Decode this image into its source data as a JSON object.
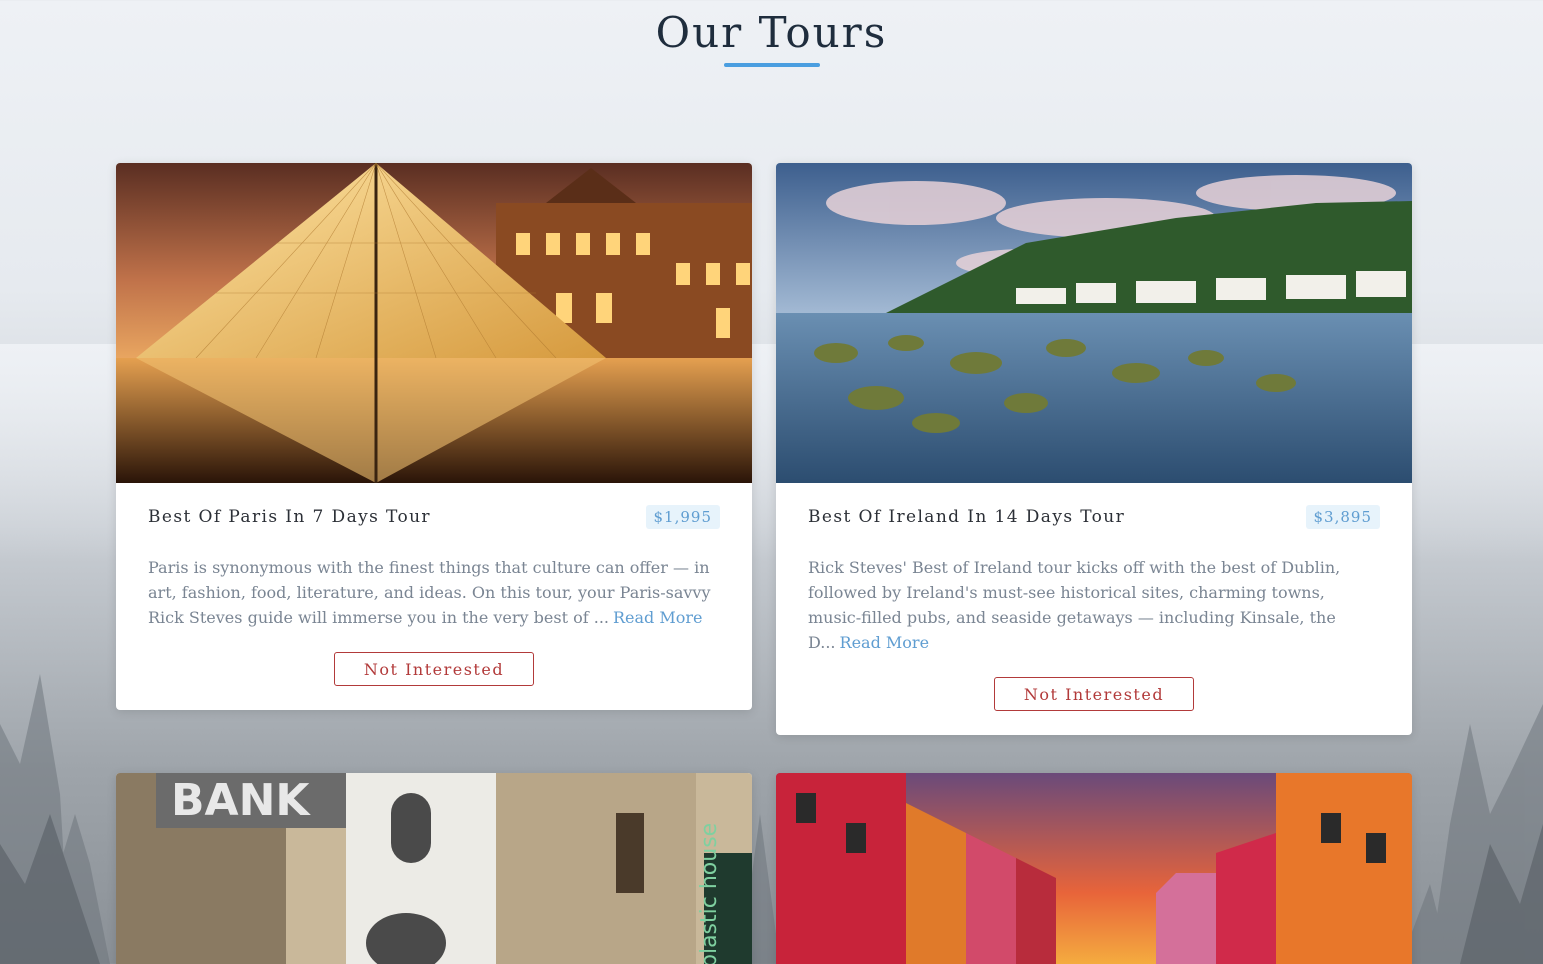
{
  "header": {
    "title": "Our Tours"
  },
  "tours": [
    {
      "title": "Best Of Paris In 7 Days Tour",
      "price": "$1,995",
      "description": "Paris is synonymous with the finest things that culture can offer — in art, fashion, food, literature, and ideas. On this tour, your Paris-savvy Rick Steves guide will immerse you in the very best of ...",
      "read_more": "Read More",
      "button": "Not Interested"
    },
    {
      "title": "Best Of Ireland In 14 Days Tour",
      "price": "$3,895",
      "description": "Rick Steves' Best of Ireland tour kicks off with the best of Dublin, followed by Ireland's must-see historical sites, charming towns, music-filled pubs, and seaside getaways — including Kinsale, the D...",
      "read_more": "Read More",
      "button": "Not Interested"
    }
  ],
  "partial_images": {
    "left_sign_text": "BANK",
    "left_sign2_text": "plastic house"
  },
  "colors": {
    "accent": "#4a9ee0",
    "price_text": "#5f9dd1",
    "button_border": "#b23a3a"
  }
}
